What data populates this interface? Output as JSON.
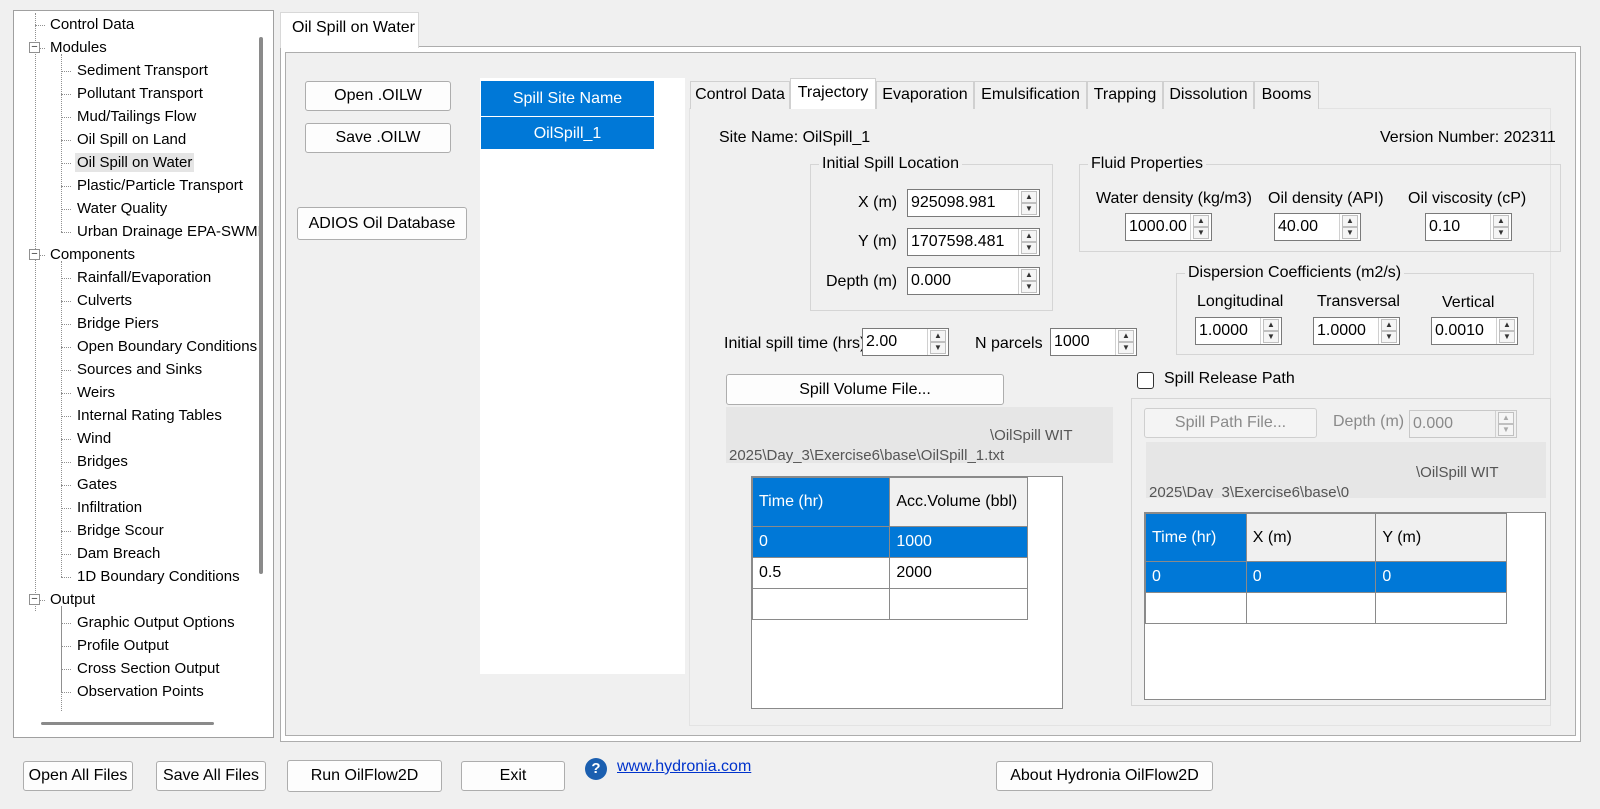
{
  "tree": {
    "items": [
      {
        "label": "Control Data",
        "level": 0,
        "expander": false
      },
      {
        "label": "Modules",
        "level": 0,
        "expander": true
      },
      {
        "label": "Sediment Transport",
        "level": 1
      },
      {
        "label": "Pollutant Transport",
        "level": 1
      },
      {
        "label": "Mud/Tailings Flow",
        "level": 1
      },
      {
        "label": "Oil Spill on Land",
        "level": 1
      },
      {
        "label": "Oil Spill on Water",
        "level": 1,
        "selected": true
      },
      {
        "label": "Plastic/Particle Transport",
        "level": 1
      },
      {
        "label": "Water Quality",
        "level": 1
      },
      {
        "label": "Urban Drainage EPA-SWMM",
        "level": 1
      },
      {
        "label": "Components",
        "level": 0,
        "expander": true
      },
      {
        "label": "Rainfall/Evaporation",
        "level": 1
      },
      {
        "label": "Culverts",
        "level": 1
      },
      {
        "label": "Bridge Piers",
        "level": 1
      },
      {
        "label": "Open Boundary Conditions",
        "level": 1
      },
      {
        "label": "Sources and Sinks",
        "level": 1
      },
      {
        "label": "Weirs",
        "level": 1
      },
      {
        "label": "Internal Rating Tables",
        "level": 1
      },
      {
        "label": "Wind",
        "level": 1
      },
      {
        "label": "Bridges",
        "level": 1
      },
      {
        "label": "Gates",
        "level": 1
      },
      {
        "label": "Infiltration",
        "level": 1
      },
      {
        "label": "Bridge Scour",
        "level": 1
      },
      {
        "label": "Dam Breach",
        "level": 1
      },
      {
        "label": "1D Boundary Conditions",
        "level": 1
      },
      {
        "label": "Output",
        "level": 0,
        "expander": true
      },
      {
        "label": "Graphic Output Options",
        "level": 1
      },
      {
        "label": "Profile Output",
        "level": 1
      },
      {
        "label": "Cross Section Output",
        "level": 1
      },
      {
        "label": "Observation Points",
        "level": 1
      }
    ]
  },
  "main_tab": "Oil Spill on Water",
  "buttons": {
    "open_oilw": "Open .OILW",
    "save_oilw": "Save .OILW",
    "adios": "ADIOS Oil Database",
    "spill_volume_file": "Spill Volume File...",
    "spill_path_file": "Spill Path File...",
    "open_all": "Open All Files",
    "save_all": "Save All Files",
    "run": "Run OilFlow2D",
    "exit": "Exit",
    "about": "About Hydronia OilFlow2D"
  },
  "spill_list": {
    "header": "Spill Site Name",
    "items": [
      "OilSpill_1"
    ]
  },
  "subtabs": [
    "Control Data",
    "Trajectory",
    "Evaporation",
    "Emulsification",
    "Trapping",
    "Dissolution",
    "Booms"
  ],
  "active_subtab": "Trajectory",
  "trajectory": {
    "site_name": "Site Name: OilSpill_1",
    "version": "Version Number: 202311",
    "initial_location": {
      "title": "Initial Spill Location",
      "x_label": "X (m)",
      "x_value": "925098.981",
      "y_label": "Y (m)",
      "y_value": "1707598.481",
      "depth_label": "Depth (m)",
      "depth_value": "0.000"
    },
    "fluid": {
      "title": "Fluid Properties",
      "water_label": "Water density (kg/m3)",
      "water_value": "1000.00",
      "oil_label": "Oil density (API)",
      "oil_value": "40.00",
      "visc_label": "Oil viscosity (cP)",
      "visc_value": "0.10"
    },
    "dispersion": {
      "title": "Dispersion Coefficients (m2/s)",
      "long_label": "Longitudinal",
      "long_value": "1.0000",
      "trans_label": "Transversal",
      "trans_value": "1.0000",
      "vert_label": "Vertical",
      "vert_value": "0.0010"
    },
    "spill_time_label": "Initial spill time (hrs)",
    "spill_time_value": "2.00",
    "nparcels_label": "N parcels",
    "nparcels_value": "1000",
    "volume_path_line1": "\\OilSpill WIT",
    "volume_path_line2": "2025\\Day_3\\Exercise6\\base\\OilSpill_1.txt",
    "volume_table": {
      "headers": [
        "Time (hr)",
        "Acc.Volume (bbl)"
      ],
      "rows": [
        [
          "0",
          "1000"
        ],
        [
          "0.5",
          "2000"
        ],
        [
          "",
          ""
        ]
      ]
    },
    "release_path": {
      "checkbox_label": "Spill Release Path",
      "checked": false,
      "depth_label": "Depth (m)",
      "depth_value": "0.000",
      "path_line1": "\\OilSpill WIT",
      "path_line2": "2025\\Day_3\\Exercise6\\base\\0",
      "table": {
        "headers": [
          "Time (hr)",
          "X (m)",
          "Y (m)"
        ],
        "rows": [
          [
            "0",
            "0",
            "0"
          ],
          [
            "",
            "",
            ""
          ]
        ]
      }
    }
  },
  "footer": {
    "help_glyph": "?",
    "link": "www.hydronia.com"
  }
}
